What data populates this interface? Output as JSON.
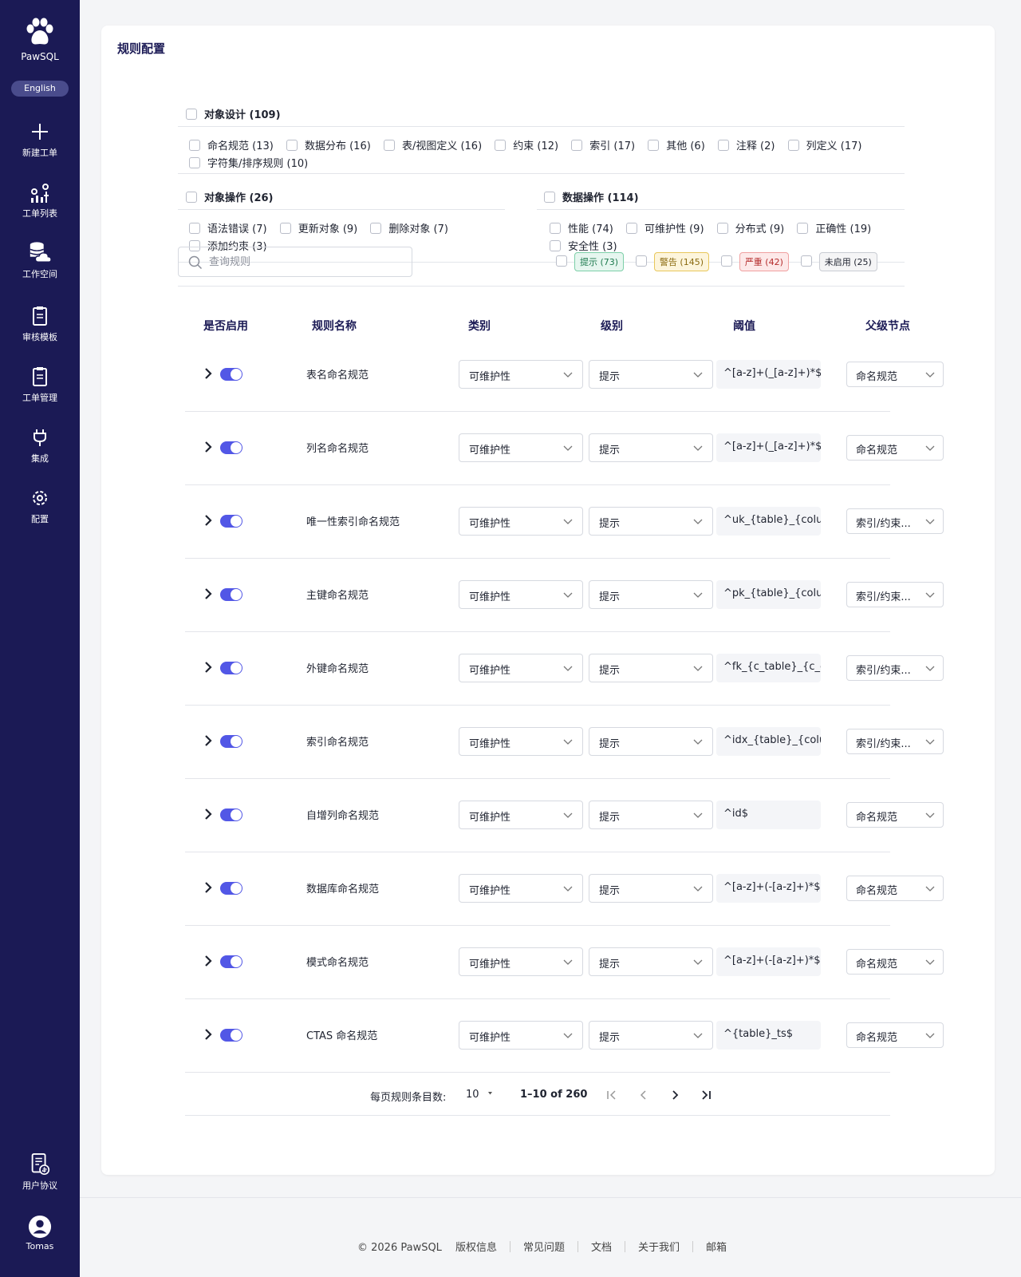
{
  "sidebar": {
    "brand": "PawSQL",
    "language": "English",
    "items": [
      {
        "label": "新建工单",
        "icon": "plus-icon"
      },
      {
        "label": "工单列表",
        "icon": "list-chart-icon"
      },
      {
        "label": "工作空间",
        "icon": "database-cloud-icon"
      },
      {
        "label": "审核模板",
        "icon": "clipboard-icon"
      },
      {
        "label": "工单管理",
        "icon": "clipboard-icon"
      },
      {
        "label": "集成",
        "icon": "plug-icon"
      },
      {
        "label": "配置",
        "icon": "gear-icon"
      }
    ],
    "agreement": "用户协议",
    "user": "Tomas"
  },
  "page": {
    "title": "规则配置"
  },
  "filters": {
    "object_design": {
      "title": "对象设计 (109)",
      "items": [
        "命名规范 (13)",
        "数据分布 (16)",
        "表/视图定义 (16)",
        "约束 (12)",
        "索引 (17)",
        "其他 (6)",
        "注释 (2)",
        "列定义 (17)",
        "字符集/排序规则 (10)"
      ]
    },
    "object_ops": {
      "title": "对象操作 (26)",
      "items": [
        "语法错误 (7)",
        "更新对象 (9)",
        "删除对象 (7)",
        "添加约束 (3)"
      ]
    },
    "data_ops": {
      "title": "数据操作 (114)",
      "items": [
        "性能 (74)",
        "可维护性 (9)",
        "分布式 (9)",
        "正确性 (19)",
        "安全性 (3)"
      ]
    }
  },
  "search": {
    "placeholder": "查询规则"
  },
  "levels": [
    {
      "label": "提示 (73)",
      "kind": "tip",
      "color": "#1e7a4f"
    },
    {
      "label": "警告 (145)",
      "kind": "warn",
      "color": "#8a6a10"
    },
    {
      "label": "严重 (42)",
      "kind": "crit",
      "color": "#b42b2b"
    },
    {
      "label": "未启用 (25)",
      "kind": "off",
      "color": "#1f2330"
    }
  ],
  "table": {
    "headers": [
      "是否启用",
      "规则名称",
      "类别",
      "级别",
      "阈值",
      "父级节点"
    ],
    "rows": [
      {
        "name": "表名命名规范",
        "category": "可维护性",
        "level": "提示",
        "threshold": "^[a-z]+(_[a-z]+)*$",
        "parent": "命名规范",
        "enabled": true
      },
      {
        "name": "列名命名规范",
        "category": "可维护性",
        "level": "提示",
        "threshold": "^[a-z]+(_[a-z]+)*$",
        "parent": "命名规范",
        "enabled": true
      },
      {
        "name": "唯一性索引命名规范",
        "category": "可维护性",
        "level": "提示",
        "threshold": "^uk_{table}_{colur",
        "parent": "索引/约束...",
        "enabled": true
      },
      {
        "name": "主键命名规范",
        "category": "可维护性",
        "level": "提示",
        "threshold": "^pk_{table}_{colur",
        "parent": "索引/约束...",
        "enabled": true
      },
      {
        "name": "外键命名规范",
        "category": "可维护性",
        "level": "提示",
        "threshold": "^fk_{c_table}_{c_c",
        "parent": "索引/约束...",
        "enabled": true
      },
      {
        "name": "索引命名规范",
        "category": "可维护性",
        "level": "提示",
        "threshold": "^idx_{table}_{colu",
        "parent": "索引/约束...",
        "enabled": true
      },
      {
        "name": "自增列命名规范",
        "category": "可维护性",
        "level": "提示",
        "threshold": "^id$",
        "parent": "命名规范",
        "enabled": true
      },
      {
        "name": "数据库命名规范",
        "category": "可维护性",
        "level": "提示",
        "threshold": "^[a-z]+(-[a-z]+)*$",
        "parent": "命名规范",
        "enabled": true
      },
      {
        "name": "模式命名规范",
        "category": "可维护性",
        "level": "提示",
        "threshold": "^[a-z]+(-[a-z]+)*$",
        "parent": "命名规范",
        "enabled": true
      },
      {
        "name": "CTAS 命名规范",
        "category": "可维护性",
        "level": "提示",
        "threshold": "^{table}_ts$",
        "parent": "命名规范",
        "enabled": true
      }
    ]
  },
  "pagination": {
    "per_page_label": "每页规则条目数:",
    "per_page": "10",
    "range": "1–10 of 260"
  },
  "footer": {
    "copyright": "© 2026 PawSQL",
    "links": [
      "版权信息",
      "常见问题",
      "文档",
      "关于我们",
      "邮箱"
    ]
  },
  "colors": {
    "sidebar": "#1b1a55",
    "accent": "#5257e6"
  }
}
